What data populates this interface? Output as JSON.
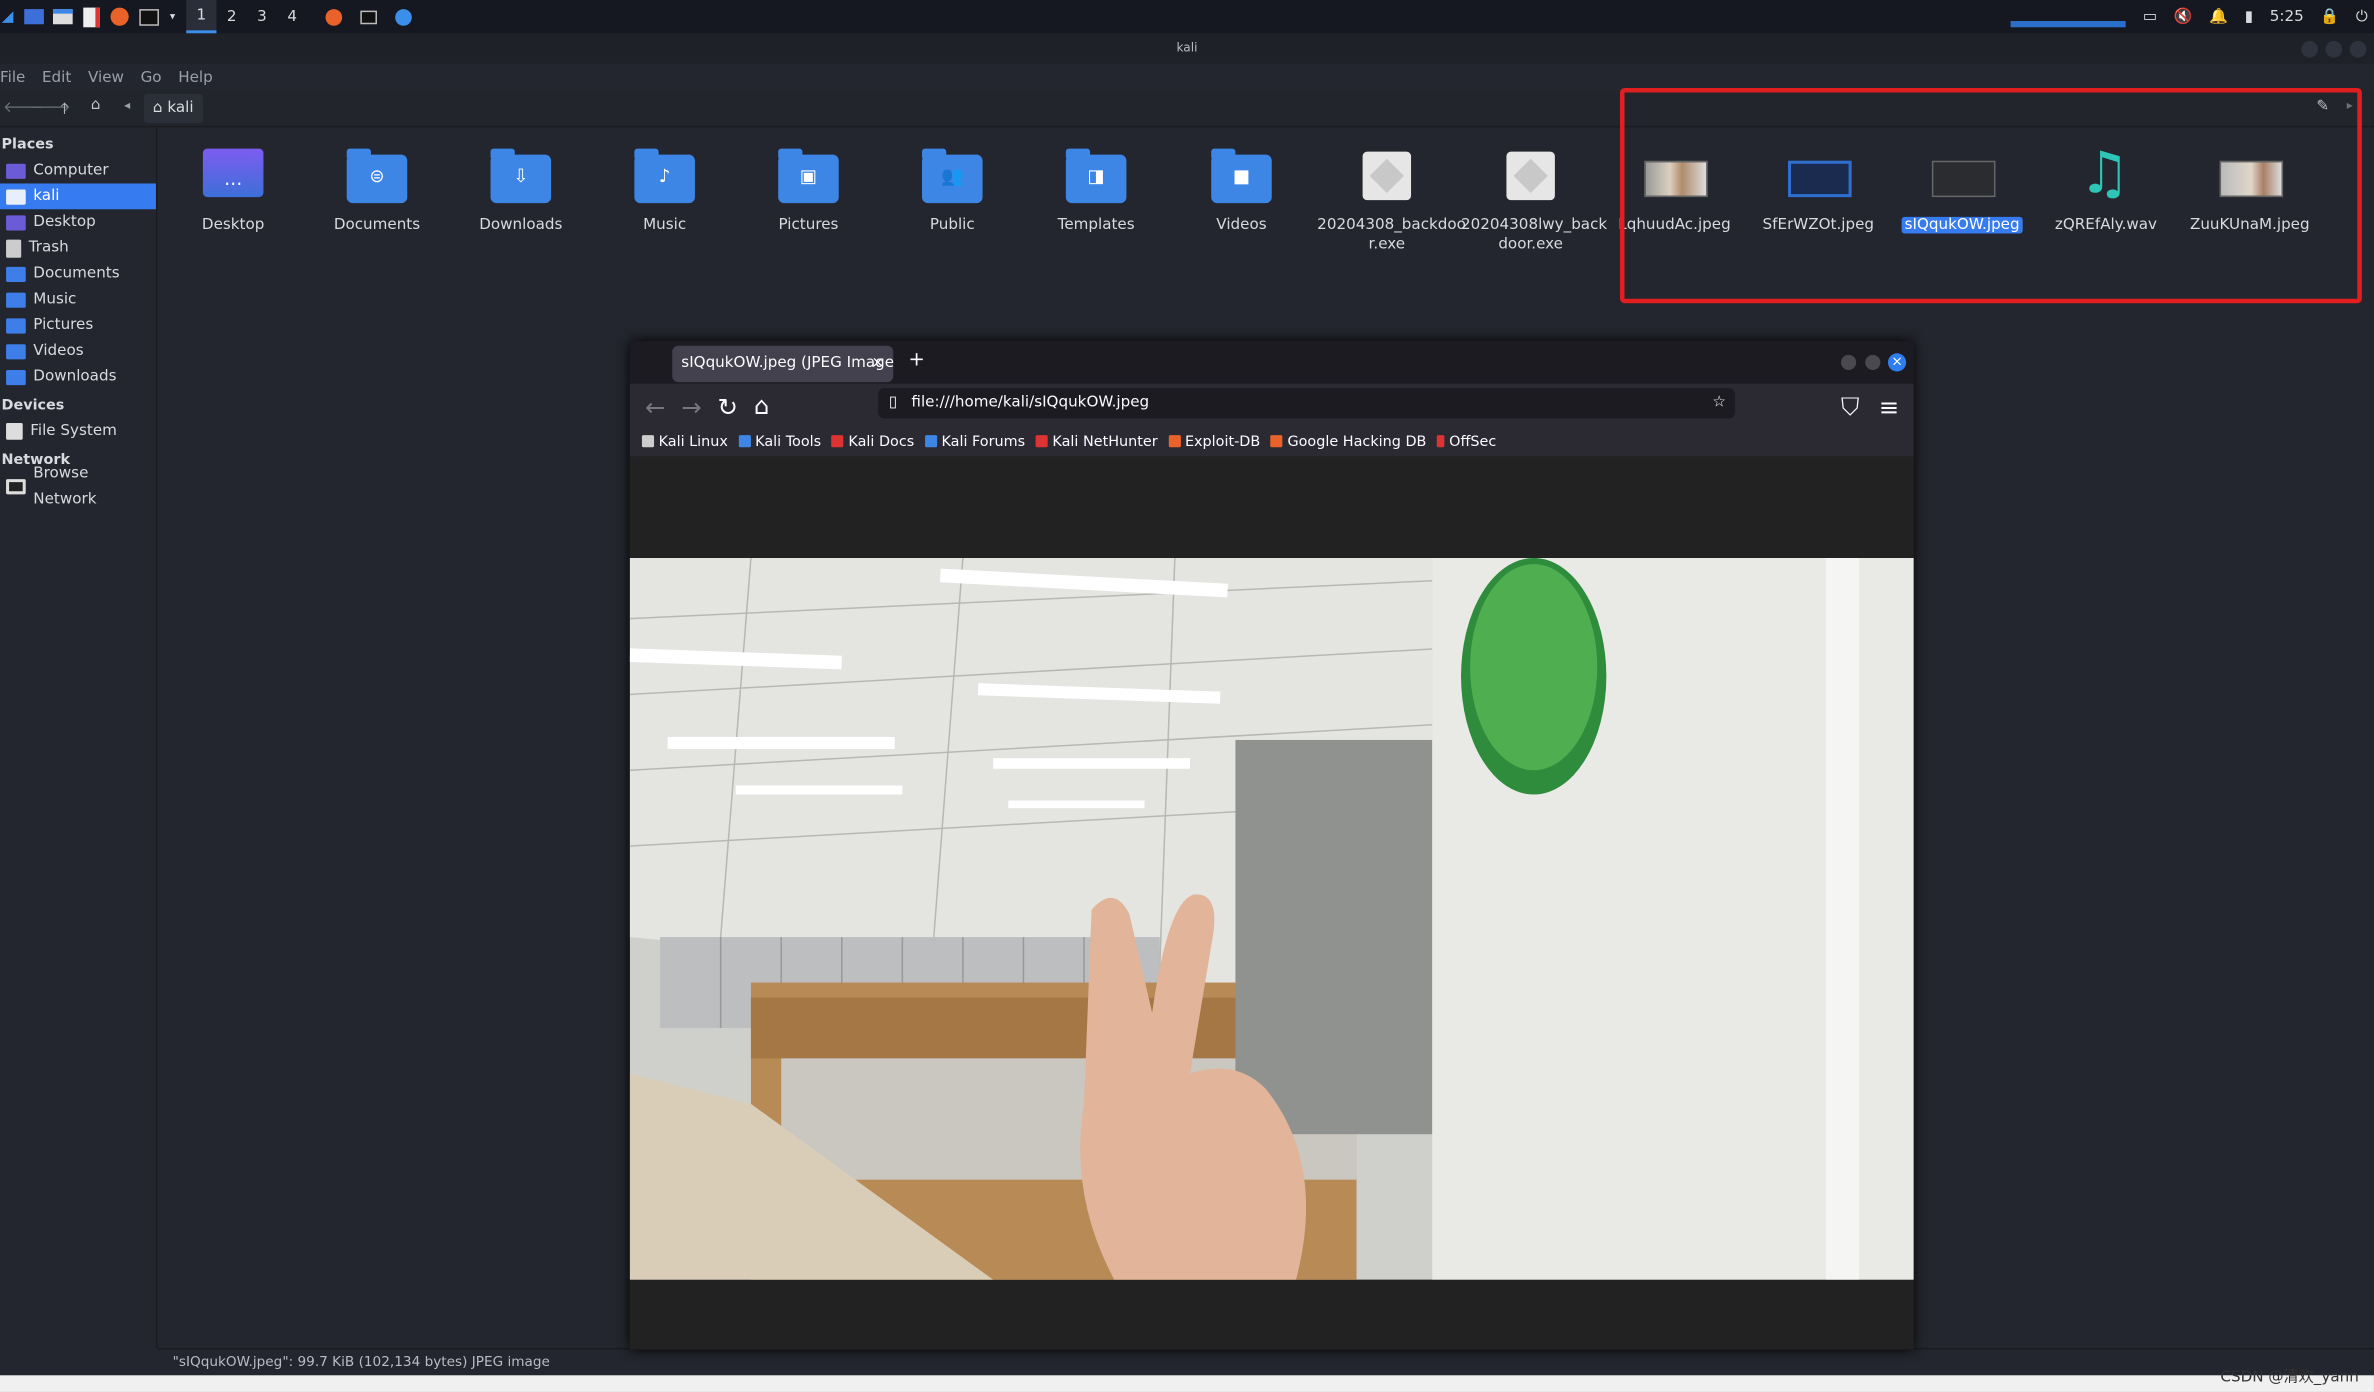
{
  "panel": {
    "workspaces": [
      "1",
      "2",
      "3",
      "4"
    ],
    "active_workspace": "1",
    "clock": "5:25"
  },
  "window": {
    "title": "kali"
  },
  "menu": [
    "File",
    "Edit",
    "View",
    "Go",
    "Help"
  ],
  "location": {
    "crumb": "kali"
  },
  "sidebar": {
    "places_header": "Places",
    "places": [
      {
        "label": "Computer"
      },
      {
        "label": "kali"
      },
      {
        "label": "Desktop"
      },
      {
        "label": "Trash"
      },
      {
        "label": "Documents"
      },
      {
        "label": "Music"
      },
      {
        "label": "Pictures"
      },
      {
        "label": "Videos"
      },
      {
        "label": "Downloads"
      }
    ],
    "devices_header": "Devices",
    "devices": [
      {
        "label": "File System"
      }
    ],
    "network_header": "Network",
    "network": [
      {
        "label": "Browse Network"
      }
    ]
  },
  "files": [
    {
      "name": "Desktop",
      "type": "folder"
    },
    {
      "name": "Documents",
      "type": "folder"
    },
    {
      "name": "Downloads",
      "type": "folder"
    },
    {
      "name": "Music",
      "type": "folder"
    },
    {
      "name": "Pictures",
      "type": "folder"
    },
    {
      "name": "Public",
      "type": "folder"
    },
    {
      "name": "Templates",
      "type": "folder"
    },
    {
      "name": "Videos",
      "type": "folder"
    },
    {
      "name": "20204308_backdoo r.exe",
      "type": "exe"
    },
    {
      "name": "20204308lwy_back door.exe",
      "type": "exe"
    },
    {
      "name": "LqhuudAc.jpeg",
      "type": "image"
    },
    {
      "name": "SfErWZOt.jpeg",
      "type": "image"
    },
    {
      "name": "sIQqukOW.jpeg",
      "type": "image"
    },
    {
      "name": "zQREfAly.wav",
      "type": "audio"
    },
    {
      "name": "ZuuKUnaM.jpeg",
      "type": "image"
    }
  ],
  "status": "\"sIQqukOW.jpeg\": 99.7 KiB (102,134 bytes) JPEG image",
  "watermark": "CSDN @清欢_yann",
  "firefox": {
    "tab_title": "sIQqukOW.jpeg (JPEG Image",
    "url": "file:///home/kali/sIQqukOW.jpeg",
    "bookmarks": [
      "Kali Linux",
      "Kali Tools",
      "Kali Docs",
      "Kali Forums",
      "Kali NetHunter",
      "Exploit-DB",
      "Google Hacking DB",
      "OffSec"
    ]
  },
  "colors": {
    "accent": "#367bf0",
    "highlight_box": "#e02020",
    "folder": "#3d86e6"
  }
}
